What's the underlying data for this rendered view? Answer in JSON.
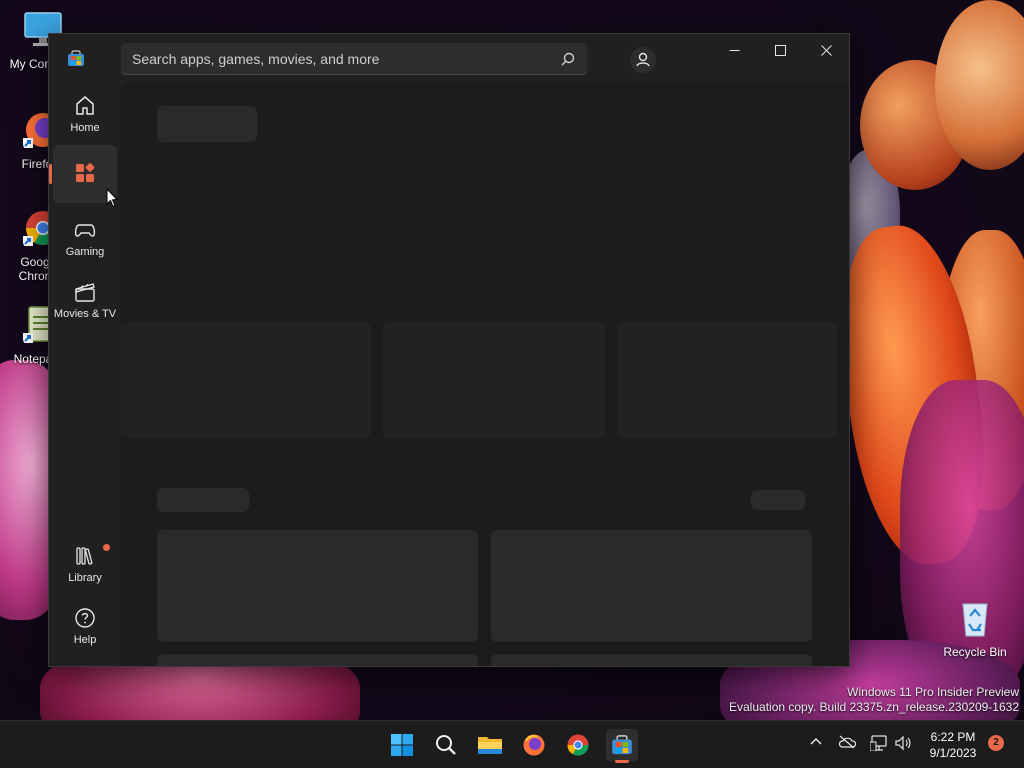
{
  "desktop": {
    "icons": [
      {
        "label": "My Com",
        "icon": "monitor-icon"
      },
      {
        "label": "Firefo",
        "icon": "firefox-icon"
      },
      {
        "label": "Goog\nChron",
        "line1": "Goog",
        "line2": "Chron",
        "icon": "chrome-icon"
      },
      {
        "label": "Notepa",
        "icon": "notepad-icon"
      },
      {
        "label": "Recycle Bin",
        "icon": "recycle-bin-icon"
      }
    ],
    "watermark_line1": "Windows 11 Pro Insider Preview",
    "watermark_line2": "Evaluation copy. Build 23375.zn_release.230209-1632"
  },
  "store": {
    "search_placeholder": "Search apps, games, movies, and more",
    "sidebar": [
      {
        "label": "Home",
        "icon": "home-icon"
      },
      {
        "label": "",
        "icon": "apps-icon",
        "active": true
      },
      {
        "label": "Gaming",
        "icon": "gamepad-icon"
      },
      {
        "label": "Movies & TV",
        "icon": "clapperboard-icon"
      },
      {
        "label": "Library",
        "icon": "library-icon",
        "badge": true
      },
      {
        "label": "Help",
        "icon": "help-icon"
      }
    ],
    "accent": "#e8684a",
    "state": "loading-skeleton"
  },
  "taskbar": {
    "apps": [
      "start-icon",
      "search-icon",
      "file-explorer-icon",
      "firefox-icon",
      "chrome-icon",
      "store-icon"
    ],
    "tray": [
      "chevron-up-icon",
      "onedrive-off-icon",
      "network-icon",
      "volume-icon"
    ],
    "time": "6:22 PM",
    "date": "9/1/2023",
    "notification_count": "2"
  }
}
